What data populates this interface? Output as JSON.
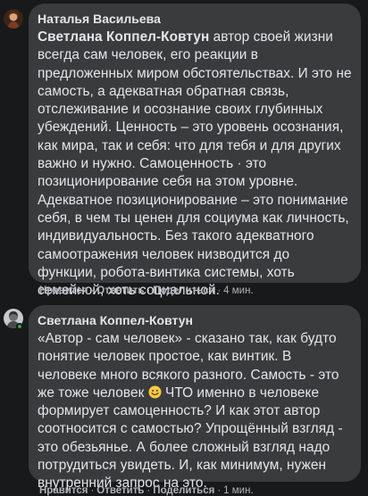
{
  "comments": [
    {
      "author": "Наталья Васильева",
      "mention": "Светлана Коппел-Ковтун",
      "text": " автор своей жизни всегда сам человек, его реакции в предложенных миром обстоятельствах. И это не самость, а адекватная обратная связь, отслеживание и осознание своих глубинных убеждений. Ценность – это уровень осознания, как мира, так и себя: что для тебя и для других важно и нужно. Самоценность · это позиционирование себя на этом уровне. Адекватное позиционирование – это понимание себя, в чем ты ценен для социума как личность, индивидуальность. Без такого адекватного самоотражения человек низводится до функции, робота-винтика системы, хоть семейной, хоть социальной.",
      "actions": {
        "like": "Нравится",
        "reply": "Ответить",
        "share": "Поделиться",
        "time": "4 мин."
      }
    },
    {
      "author": "Светлана Коппел-Ковтун",
      "text_before_emoji": "«Автор - сам человек» - сказано так, как будто понятие человек простое, как винтик. В человеке много всякого разного. Самость - это же тоже человек ",
      "text_after_emoji": " ЧТО именно в человеке формирует самоценность? И как этот автор соотносится с самостью? Упрощённый взгляд - это обезьянье. А более сложный взгляд надо потрудиться увидеть. И, как минимум, нужен внутренний запрос на это.",
      "actions": {
        "like": "Нравится",
        "reply": "Ответить",
        "share": "Поделиться",
        "time": "1 мин."
      }
    }
  ],
  "icons": {
    "emoji": "smiling-face-emoji",
    "online": "online-status-dot"
  },
  "colors": {
    "background": "#18191a",
    "bubble": "#3a3b3c",
    "text": "#e4e6eb",
    "secondary": "#b0b3b8",
    "online": "#31a24c"
  }
}
